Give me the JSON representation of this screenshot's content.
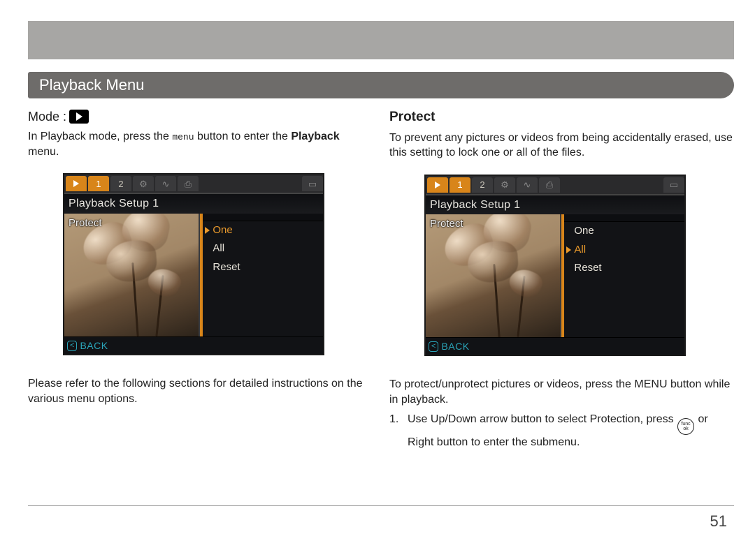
{
  "header": {
    "title": "Playback Menu"
  },
  "left": {
    "mode_label": "Mode :",
    "intro_pre": "In Playback mode, press the ",
    "intro_menu_word": "menu",
    "intro_mid": " button to enter the ",
    "intro_bold": "Playback",
    "intro_post": " menu.",
    "screen": {
      "tabs": {
        "play_icon": "▶",
        "t1": "1",
        "t2": "2",
        "wrench": "⚙",
        "wave": "∿",
        "misc": "⎙",
        "batt": "▭"
      },
      "title": "Playback Setup 1",
      "item": "Protect",
      "options": [
        "One",
        "All",
        "Reset"
      ],
      "selected": "One",
      "back_key": "<",
      "back_label": "BACK"
    },
    "footnote": "Please refer to the following sections for detailed instructions on the various menu options."
  },
  "right": {
    "heading": "Protect",
    "intro": "To prevent any pictures or videos from being accidentally erased, use this setting to lock one or all of the files.",
    "screen": {
      "title": "Playback Setup 1",
      "item": "Protect",
      "options": [
        "One",
        "All",
        "Reset"
      ],
      "selected": "All",
      "back_key": "<",
      "back_label": "BACK"
    },
    "below1": "To protect/unprotect pictures or videos, press the MENU button while in playback.",
    "step1_num": "1.",
    "step1_a": "Use Up/Down arrow button to select Protection, press ",
    "func_top": "func",
    "func_bot": "ok",
    "step1_b": " or Right button to enter the submenu."
  },
  "page_number": "51"
}
